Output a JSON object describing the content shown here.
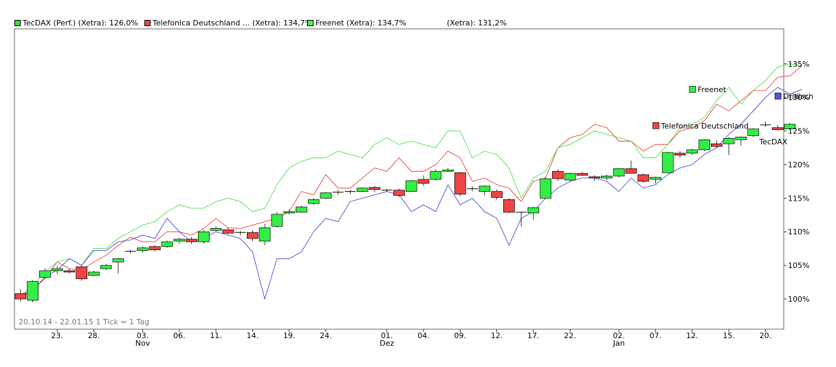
{
  "legend": [
    {
      "label": "TecDAX (Perf.) (Xetra): 126,0%",
      "color": "#33dd44"
    },
    {
      "label": "Telefonica Deutschland ... (Xetra): 134,7%",
      "color": "#ee4444"
    },
    {
      "label": "Freenet (Xetra): 134,7%",
      "color": "#55ee55"
    },
    {
      "label": "(Xetra): 131,2%",
      "color": null
    }
  ],
  "range_note": "20.10.14 - 22.01.15   1 Tick = 1 Tag",
  "colors": {
    "up": "#33ee44",
    "down": "#ee4444",
    "line_telefonica": "#ee2222",
    "line_freenet": "#33dd33",
    "line_drillisch": "#3333cc",
    "grid": "#000000"
  },
  "chart_data": {
    "type": "candlestick",
    "title": "",
    "ylabel": "",
    "xlabel": "",
    "y_unit": "%",
    "ylim": [
      95.5,
      140.2
    ],
    "grid": false,
    "y_ticks": [
      "100%",
      "105%",
      "110%",
      "115%",
      "120%",
      "125%",
      "130%",
      "135%"
    ],
    "y_tick_values": [
      100,
      105,
      110,
      115,
      120,
      125,
      130,
      135
    ],
    "x_ticks": [
      {
        "day": 3,
        "label": "23."
      },
      {
        "day": 6,
        "label": "28."
      },
      {
        "day": 10,
        "label": "03."
      },
      {
        "day": 13,
        "label": "06."
      },
      {
        "day": 16,
        "label": "11."
      },
      {
        "day": 19,
        "label": "14."
      },
      {
        "day": 22,
        "label": "19."
      },
      {
        "day": 25,
        "label": "24."
      },
      {
        "day": 30,
        "label": "01."
      },
      {
        "day": 33,
        "label": "04."
      },
      {
        "day": 36,
        "label": "09."
      },
      {
        "day": 39,
        "label": "12."
      },
      {
        "day": 42,
        "label": "17."
      },
      {
        "day": 45,
        "label": "22."
      },
      {
        "day": 49,
        "label": "02."
      },
      {
        "day": 52,
        "label": "07."
      },
      {
        "day": 55,
        "label": "12."
      },
      {
        "day": 58,
        "label": "15."
      },
      {
        "day": 61,
        "label": "20."
      }
    ],
    "x_month_labels": [
      {
        "day": 10,
        "label": "Nov"
      },
      {
        "day": 30,
        "label": "Dez"
      },
      {
        "day": 49,
        "label": "Jan"
      }
    ],
    "n_days": 63,
    "candles": [
      {
        "o": 100.8,
        "h": 101.5,
        "l": 99.6,
        "c": 100.0
      },
      {
        "o": 99.8,
        "h": 102.8,
        "l": 99.5,
        "c": 102.6
      },
      {
        "o": 103.2,
        "h": 104.5,
        "l": 103.0,
        "c": 104.2
      },
      {
        "o": 104.2,
        "h": 104.9,
        "l": 103.7,
        "c": 104.5
      },
      {
        "o": 104.2,
        "h": 104.5,
        "l": 103.8,
        "c": 104.0
      },
      {
        "o": 104.8,
        "h": 105.0,
        "l": 102.7,
        "c": 103.0
      },
      {
        "o": 103.5,
        "h": 104.2,
        "l": 103.4,
        "c": 104.0
      },
      {
        "o": 104.5,
        "h": 105.2,
        "l": 104.3,
        "c": 105.0
      },
      {
        "o": 105.5,
        "h": 106.1,
        "l": 103.8,
        "c": 106.0
      },
      {
        "o": 107.0,
        "h": 107.3,
        "l": 106.8,
        "c": 107.1
      },
      {
        "o": 107.2,
        "h": 107.8,
        "l": 106.9,
        "c": 107.6
      },
      {
        "o": 107.8,
        "h": 108.0,
        "l": 107.1,
        "c": 107.3
      },
      {
        "o": 107.8,
        "h": 108.7,
        "l": 107.6,
        "c": 108.5
      },
      {
        "o": 108.6,
        "h": 109.1,
        "l": 108.2,
        "c": 108.9
      },
      {
        "o": 108.9,
        "h": 109.2,
        "l": 108.2,
        "c": 108.5
      },
      {
        "o": 108.5,
        "h": 110.3,
        "l": 108.2,
        "c": 110.0
      },
      {
        "o": 110.2,
        "h": 110.8,
        "l": 110.1,
        "c": 110.5
      },
      {
        "o": 110.3,
        "h": 110.6,
        "l": 109.6,
        "c": 109.8
      },
      {
        "o": 109.8,
        "h": 110.1,
        "l": 109.5,
        "c": 109.9
      },
      {
        "o": 109.9,
        "h": 110.2,
        "l": 108.6,
        "c": 109.0
      },
      {
        "o": 108.6,
        "h": 111.2,
        "l": 108.0,
        "c": 110.6
      },
      {
        "o": 110.8,
        "h": 112.9,
        "l": 110.6,
        "c": 112.6
      },
      {
        "o": 112.8,
        "h": 113.3,
        "l": 112.6,
        "c": 113.0
      },
      {
        "o": 112.9,
        "h": 113.9,
        "l": 112.8,
        "c": 113.7
      },
      {
        "o": 114.2,
        "h": 115.0,
        "l": 114.0,
        "c": 114.8
      },
      {
        "o": 115.0,
        "h": 115.9,
        "l": 114.9,
        "c": 115.8
      },
      {
        "o": 115.8,
        "h": 116.2,
        "l": 115.5,
        "c": 115.9
      },
      {
        "o": 115.9,
        "h": 116.2,
        "l": 115.6,
        "c": 116.0
      },
      {
        "o": 116.0,
        "h": 116.6,
        "l": 115.9,
        "c": 116.5
      },
      {
        "o": 116.6,
        "h": 116.8,
        "l": 115.9,
        "c": 116.3
      },
      {
        "o": 116.2,
        "h": 116.4,
        "l": 116.0,
        "c": 116.2
      },
      {
        "o": 116.2,
        "h": 116.4,
        "l": 115.2,
        "c": 115.4
      },
      {
        "o": 116.0,
        "h": 117.7,
        "l": 115.9,
        "c": 117.6
      },
      {
        "o": 117.8,
        "h": 118.4,
        "l": 116.8,
        "c": 117.2
      },
      {
        "o": 117.8,
        "h": 119.3,
        "l": 117.6,
        "c": 119.0
      },
      {
        "o": 119.0,
        "h": 119.5,
        "l": 118.9,
        "c": 119.2
      },
      {
        "o": 118.8,
        "h": 118.9,
        "l": 115.3,
        "c": 115.6
      },
      {
        "o": 116.3,
        "h": 116.8,
        "l": 116.0,
        "c": 116.4
      },
      {
        "o": 116.0,
        "h": 116.9,
        "l": 115.4,
        "c": 116.8
      },
      {
        "o": 116.0,
        "h": 116.3,
        "l": 114.8,
        "c": 115.1
      },
      {
        "o": 114.8,
        "h": 115.0,
        "l": 112.8,
        "c": 112.9
      },
      {
        "o": 112.8,
        "h": 113.0,
        "l": 110.8,
        "c": 112.9
      },
      {
        "o": 112.8,
        "h": 113.7,
        "l": 111.8,
        "c": 113.6
      },
      {
        "o": 115.0,
        "h": 118.1,
        "l": 114.9,
        "c": 117.9
      },
      {
        "o": 119.0,
        "h": 119.3,
        "l": 117.6,
        "c": 117.9
      },
      {
        "o": 117.7,
        "h": 118.8,
        "l": 117.5,
        "c": 118.7
      },
      {
        "o": 118.7,
        "h": 118.9,
        "l": 118.3,
        "c": 118.4
      },
      {
        "o": 118.2,
        "h": 118.4,
        "l": 117.6,
        "c": 118.0
      },
      {
        "o": 118.0,
        "h": 118.5,
        "l": 117.7,
        "c": 118.3
      },
      {
        "o": 118.3,
        "h": 119.5,
        "l": 118.1,
        "c": 119.4
      },
      {
        "o": 119.4,
        "h": 120.6,
        "l": 118.7,
        "c": 118.7
      },
      {
        "o": 118.5,
        "h": 118.7,
        "l": 117.3,
        "c": 117.5
      },
      {
        "o": 117.8,
        "h": 118.2,
        "l": 117.2,
        "c": 118.1
      },
      {
        "o": 118.8,
        "h": 121.9,
        "l": 118.7,
        "c": 121.8
      },
      {
        "o": 121.7,
        "h": 122.0,
        "l": 121.0,
        "c": 121.4
      },
      {
        "o": 121.7,
        "h": 122.4,
        "l": 121.4,
        "c": 122.2
      },
      {
        "o": 122.2,
        "h": 123.8,
        "l": 122.0,
        "c": 123.7
      },
      {
        "o": 123.1,
        "h": 123.6,
        "l": 122.5,
        "c": 122.7
      },
      {
        "o": 123.1,
        "h": 124.1,
        "l": 121.4,
        "c": 123.9
      },
      {
        "o": 123.7,
        "h": 124.2,
        "l": 122.8,
        "c": 124.1
      },
      {
        "o": 124.3,
        "h": 125.4,
        "l": 124.1,
        "c": 125.3
      },
      {
        "o": 125.8,
        "h": 126.4,
        "l": 125.6,
        "c": 125.9
      },
      {
        "o": 125.5,
        "h": 125.9,
        "l": 125.0,
        "c": 125.2
      },
      {
        "o": 125.3,
        "h": 126.2,
        "l": 125.2,
        "c": 126.0
      }
    ],
    "series": [
      {
        "key": "telefonica",
        "name": "Telefonica Deutschland",
        "values": [
          100.5,
          101.5,
          103.0,
          105.5,
          104.5,
          104.3,
          105.5,
          106.5,
          108.0,
          109.2,
          108.5,
          108.5,
          110.0,
          110.0,
          109.5,
          110.5,
          112.0,
          110.6,
          110.5,
          111.0,
          111.5,
          112.0,
          113.0,
          116.0,
          115.5,
          118.5,
          116.5,
          116.5,
          118.0,
          119.5,
          119.0,
          121.0,
          119.0,
          119.0,
          120.0,
          122.0,
          121.0,
          117.5,
          118.0,
          117.0,
          116.5,
          114.5,
          117.5,
          118.0,
          122.5,
          124.0,
          124.5,
          126.0,
          125.5,
          123.5,
          123.5,
          122.0,
          123.0,
          123.0,
          125.0,
          125.5,
          126.5,
          129.0,
          128.0,
          129.5,
          131.0,
          131.0,
          133.0,
          133.2,
          134.7
        ]
      },
      {
        "key": "freenet",
        "name": "Freenet",
        "values": [
          100.5,
          102.0,
          104.0,
          105.5,
          106.0,
          105.0,
          107.5,
          107.5,
          109.0,
          110.0,
          111.0,
          111.5,
          113.0,
          114.0,
          113.5,
          113.5,
          114.5,
          115.0,
          114.5,
          113.0,
          113.5,
          117.0,
          119.5,
          120.5,
          121.0,
          121.0,
          122.0,
          121.5,
          121.0,
          123.0,
          124.0,
          123.0,
          123.5,
          123.0,
          122.5,
          125.0,
          125.0,
          121.0,
          122.0,
          121.5,
          119.5,
          115.0,
          118.0,
          119.0,
          122.5,
          123.0,
          124.0,
          125.0,
          124.5,
          124.0,
          123.5,
          121.0,
          121.0,
          123.0,
          125.5,
          126.0,
          127.0,
          129.5,
          131.5,
          129.0,
          131.0,
          132.5,
          134.5,
          135.0,
          134.7
        ]
      },
      {
        "key": "drillisch",
        "name": "Drillisch",
        "values": [
          100.3,
          101.2,
          103.3,
          104.3,
          106.0,
          105.0,
          107.2,
          107.2,
          108.5,
          108.8,
          109.5,
          109.0,
          112.0,
          110.0,
          108.5,
          109.0,
          110.0,
          109.5,
          109.0,
          107.0,
          100.0,
          106.0,
          106.0,
          107.0,
          110.0,
          112.0,
          111.5,
          114.5,
          115.0,
          115.5,
          116.0,
          115.5,
          113.0,
          114.0,
          113.0,
          117.0,
          114.0,
          115.0,
          113.0,
          112.0,
          108.0,
          112.0,
          113.0,
          115.0,
          116.5,
          117.5,
          118.0,
          118.0,
          117.5,
          116.0,
          118.0,
          116.5,
          117.0,
          118.5,
          119.5,
          120.0,
          121.5,
          122.5,
          124.5,
          126.0,
          128.0,
          130.0,
          131.5,
          130.5,
          131.2
        ]
      }
    ],
    "tags": [
      {
        "series": "freenet",
        "text": "Freenet",
        "value": 131.2,
        "day": 55
      },
      {
        "series": "telefonica",
        "text": "Telefonica Deutschland",
        "value": 125.8,
        "day": 52
      },
      {
        "series": "drillisch",
        "text": "Drillisch",
        "value": 130.2,
        "day": 62
      },
      {
        "series": "tecdax",
        "text": "TecDAX",
        "value": 123.4,
        "day": 61
      }
    ]
  }
}
